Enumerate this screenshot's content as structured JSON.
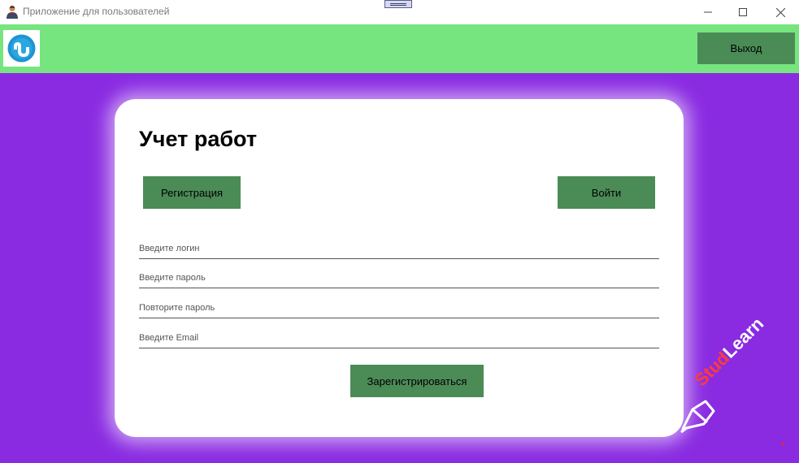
{
  "window": {
    "title": "Приложение для пользователей",
    "controls": [
      "minimize-icon",
      "maximize-icon",
      "close-icon"
    ]
  },
  "header": {
    "logo_icon": "stumbleupon-logo-icon",
    "exit_label": "Выход",
    "bg_color": "#77e57f"
  },
  "card": {
    "title": "Учет работ",
    "register_tab_label": "Регистрация",
    "login_tab_label": "Войти",
    "fields": {
      "login_placeholder": "Введите логин",
      "password_placeholder": "Введите пароль",
      "repeat_password_placeholder": "Повторите пароль",
      "email_placeholder": "Введите Email"
    },
    "submit_label": "Зарегистрироваться"
  },
  "watermark": {
    "text_red": "Stud",
    "text_white": "Learn"
  },
  "colors": {
    "background": "#8a2be2",
    "button": "#4b8b56",
    "header": "#77e57f"
  }
}
